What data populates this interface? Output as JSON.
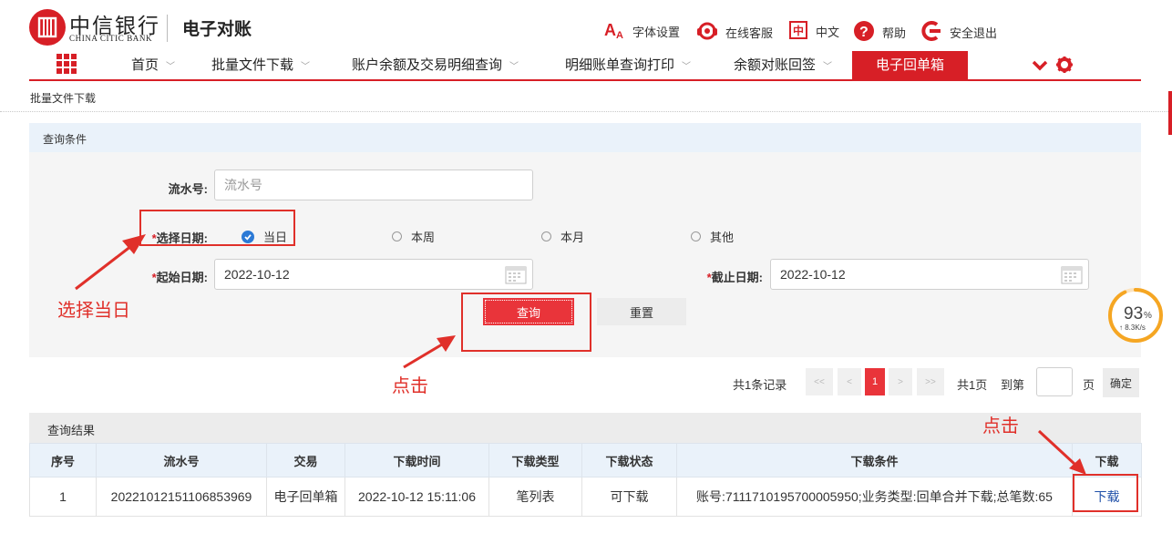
{
  "header": {
    "bank_cn": "中信银行",
    "bank_en": "CHINA CITIC BANK",
    "app_name": "电子对账",
    "tools": [
      {
        "icon": "font-size-icon",
        "label": "字体设置"
      },
      {
        "icon": "customer-service-icon",
        "label": "在线客服"
      },
      {
        "icon": "language-icon",
        "label": "中文",
        "icon_text": "中"
      },
      {
        "icon": "help-icon",
        "label": "帮助"
      },
      {
        "icon": "logout-icon",
        "label": "安全退出"
      }
    ]
  },
  "nav": {
    "items": [
      {
        "label": "首页",
        "active": false
      },
      {
        "label": "批量文件下载",
        "active": false
      },
      {
        "label": "账户余额及交易明细查询",
        "active": false
      },
      {
        "label": "明细账单查询打印",
        "active": false
      },
      {
        "label": "余额对账回签",
        "active": false
      },
      {
        "label": "电子回单箱",
        "active": true
      }
    ]
  },
  "breadcrumb": "批量文件下载",
  "query": {
    "title": "查询条件",
    "serial_label": "流水号:",
    "serial_placeholder": "流水号",
    "date_label": "选择日期:",
    "date_options": [
      {
        "label": "当日",
        "checked": true
      },
      {
        "label": "本周",
        "checked": false
      },
      {
        "label": "本月",
        "checked": false
      },
      {
        "label": "其他",
        "checked": false
      }
    ],
    "start_label": "起始日期:",
    "start_value": "2022-10-12",
    "end_label": "截止日期:",
    "end_value": "2022-10-12",
    "query_button": "查询",
    "reset_button": "重置",
    "required_mark": "*"
  },
  "pager": {
    "total_records": "共1条记录",
    "first": "<<",
    "prev": "<",
    "current": "1",
    "next": ">",
    "last": ">>",
    "total_pages": "共1页",
    "goto_label": "到第",
    "page_unit": "页",
    "confirm": "确定"
  },
  "results": {
    "title": "查询结果",
    "columns": [
      "序号",
      "流水号",
      "交易",
      "下载时间",
      "下载类型",
      "下载状态",
      "下载条件",
      "下载"
    ],
    "rows": [
      [
        "1",
        "20221012151106853969",
        "电子回单箱",
        "2022-10-12 15:11:06",
        "笔列表",
        "可下载",
        "账号:7111710195700005950;业务类型:回单合并下载;总笔数:65",
        "下载"
      ]
    ]
  },
  "annotations": {
    "select_today": "选择当日",
    "click_query": "点击",
    "click_download": "点击"
  },
  "widget": {
    "percent": "93",
    "percent_unit": "%",
    "speed": "↑ 8.3K/s",
    "level": 0.93
  },
  "colors": {
    "brand_red": "#d71f26",
    "button_red": "#e9343a",
    "annotation_red": "#e0302a",
    "link_blue": "#1f4fa8",
    "check_blue": "#2c7ad6",
    "gauge_orange": "#f5a623"
  }
}
